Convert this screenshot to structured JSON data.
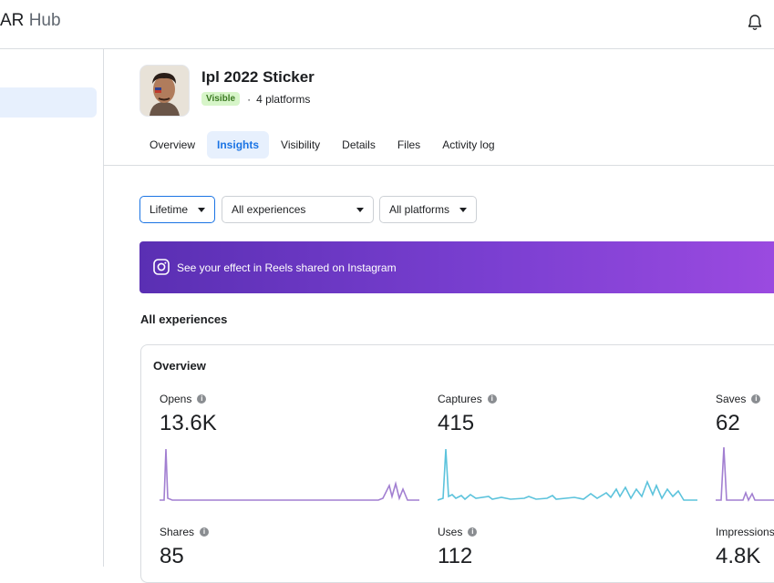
{
  "app": {
    "brand_main": "AR",
    "brand_sub": "Hub"
  },
  "effect": {
    "title": "Ipl 2022 Sticker",
    "status": "Visible",
    "separator": "·",
    "platforms": "4 platforms"
  },
  "tabs": [
    "Overview",
    "Insights",
    "Visibility",
    "Details",
    "Files",
    "Activity log"
  ],
  "active_tab": "Insights",
  "filters": {
    "time": "Lifetime",
    "experience": "All experiences",
    "platform": "All platforms"
  },
  "banner": {
    "text": "See your effect in Reels shared on Instagram"
  },
  "section": {
    "title": "All experiences"
  },
  "overview": {
    "title": "Overview",
    "metrics": [
      {
        "label": "Opens",
        "value": "13.6K",
        "color": "#a27fd1"
      },
      {
        "label": "Captures",
        "value": "415",
        "color": "#5cc3dc"
      },
      {
        "label": "Saves",
        "value": "62",
        "color": "#a27fd1"
      },
      {
        "label": "Shares",
        "value": "85"
      },
      {
        "label": "Uses",
        "value": "112"
      },
      {
        "label": "Impressions",
        "value": "4.8K"
      }
    ]
  },
  "colors": {
    "accent": "#1b74e4",
    "badge_bg": "#d7f5c9",
    "badge_text": "#3b7a22",
    "banner_start": "#5a2fb3",
    "banner_end": "#9b4ae0"
  },
  "icons": {
    "notification": "bell-icon",
    "instagram": "instagram-icon",
    "info": "info-icon",
    "dropdown": "caret-down-icon"
  }
}
